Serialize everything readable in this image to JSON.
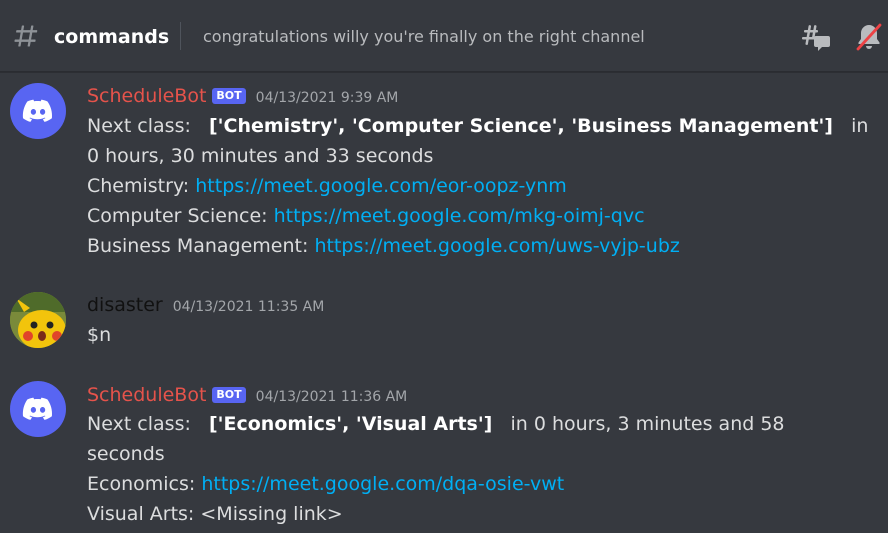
{
  "header": {
    "channel_name": "commands",
    "topic": "congratulations willy you're finally on the right channel"
  },
  "messages": [
    {
      "username": "ScheduleBot",
      "bot_tag": "BOT",
      "timestamp": "04/13/2021 9:39 AM",
      "next_class_label": "Next class:",
      "next_class_value": "['Chemistry', 'Computer Science', 'Business Management']",
      "in_prefix": "in",
      "time_line": "0 hours, 30 minutes and 33 seconds",
      "links": [
        {
          "label": "Chemistry: ",
          "url": "https://meet.google.com/eor-oopz-ynm"
        },
        {
          "label": "Computer Science: ",
          "url": "https://meet.google.com/mkg-oimj-qvc"
        },
        {
          "label": "Business Management: ",
          "url": "https://meet.google.com/uws-vyjp-ubz"
        }
      ]
    },
    {
      "username": "disaster",
      "timestamp": "04/13/2021 11:35 AM",
      "text": "$n"
    },
    {
      "username": "ScheduleBot",
      "bot_tag": "BOT",
      "timestamp": "04/13/2021 11:36 AM",
      "next_class_label": "Next class:",
      "next_class_value": "['Economics', 'Visual Arts']",
      "in_time": "in 0 hours, 3 minutes and 58",
      "time_line": "seconds",
      "links": [
        {
          "label": "Economics: ",
          "url": "https://meet.google.com/dqa-osie-vwt"
        },
        {
          "label": "Visual Arts: ",
          "url": "<Missing link>"
        }
      ]
    }
  ]
}
